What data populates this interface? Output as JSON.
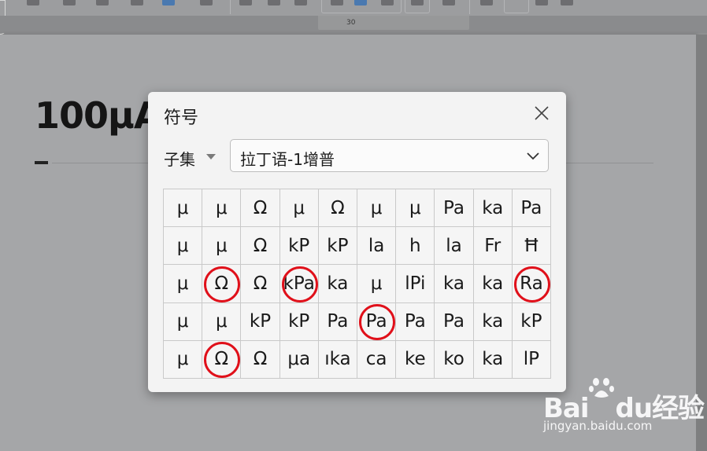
{
  "ruler": {
    "marker": "30"
  },
  "document": {
    "heading": "100μA"
  },
  "dialog": {
    "title": "符号",
    "subset_label": "子集",
    "subset_value": "拉丁语-1增普"
  },
  "symbols": [
    [
      "μ",
      "μ",
      "Ω",
      "μ",
      "Ω",
      "μ",
      "μ",
      "Pa",
      "ka",
      "Pa"
    ],
    [
      "μ",
      "μ",
      "Ω",
      "kP",
      "kP",
      "la",
      "h",
      "la",
      "Fr",
      "Ħ"
    ],
    [
      "μ",
      "Ω",
      "Ω",
      "kPa",
      "ka",
      "μ",
      "lPi",
      "ka",
      "ka",
      "Ra"
    ],
    [
      "μ",
      "μ",
      "kP",
      "kP",
      "Pa",
      "Pa",
      "Pa",
      "Pa",
      "ka",
      "kP"
    ],
    [
      "μ",
      "Ω",
      "Ω",
      "μa",
      "ıka",
      "ca",
      "ke",
      "ko",
      "ka",
      "lP"
    ]
  ],
  "highlighted": [
    [
      2,
      1
    ],
    [
      2,
      3
    ],
    [
      2,
      9
    ],
    [
      3,
      5
    ],
    [
      4,
      1
    ]
  ],
  "highlight_color": "#e0101a",
  "watermark": {
    "brand": "Bai",
    "brand_suffix": "du",
    "service": "经验",
    "url": "jingyan.baidu.com"
  }
}
